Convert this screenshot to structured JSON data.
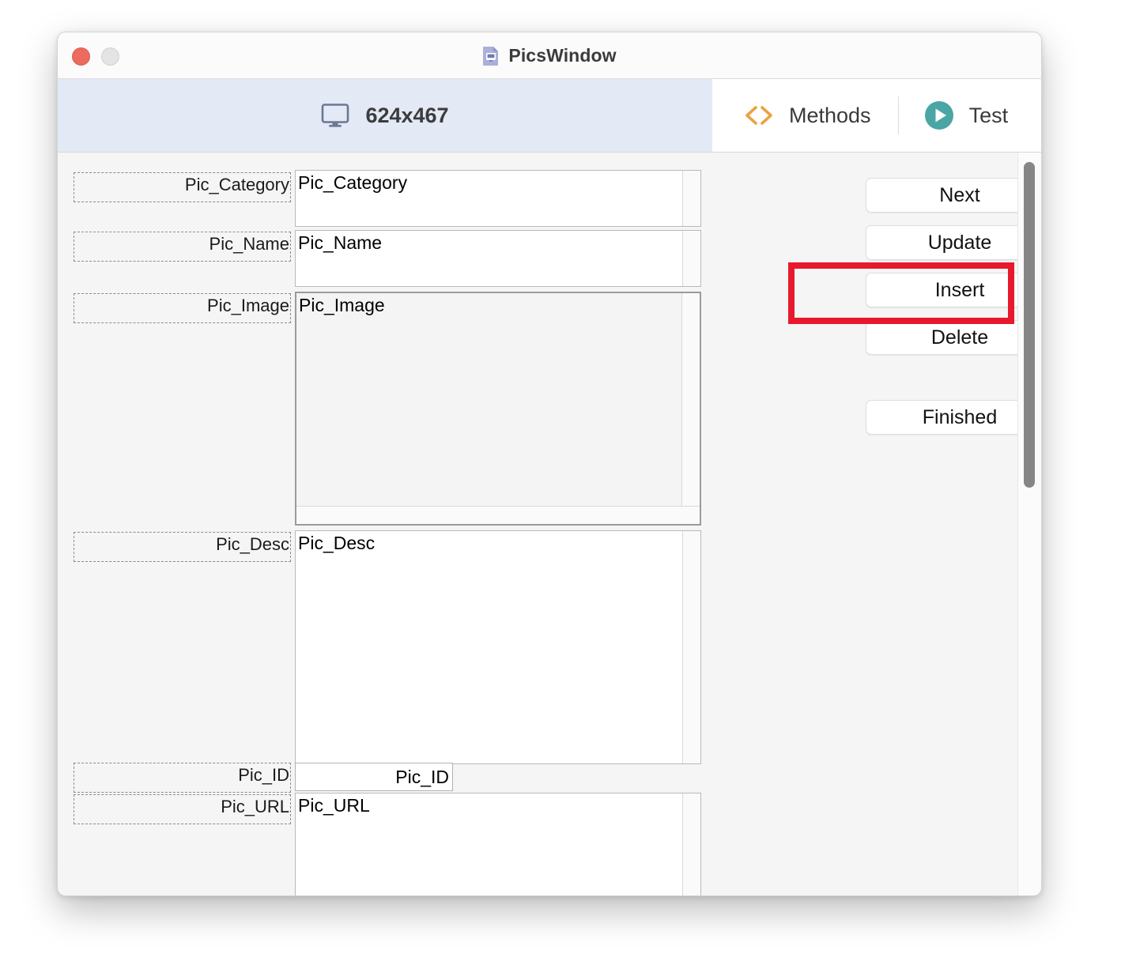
{
  "window": {
    "title": "PicsWindow",
    "title_icon": "document-window-icon",
    "traffic_lights": [
      "close",
      "minimize"
    ]
  },
  "toolbar": {
    "size_tab": {
      "icon": "monitor-icon",
      "label": "624x467"
    },
    "methods_tab": {
      "icon": "code-brackets-icon",
      "label": "Methods"
    },
    "test_tab": {
      "icon": "play-circle-icon",
      "label": "Test"
    }
  },
  "form": {
    "fields": [
      {
        "label": "Pic_Category",
        "value": "Pic_Category",
        "type": "textarea",
        "focused": false
      },
      {
        "label": "Pic_Name",
        "value": "Pic_Name",
        "type": "textarea",
        "focused": false
      },
      {
        "label": "Pic_Image",
        "value": "Pic_Image",
        "type": "textarea",
        "focused": true
      },
      {
        "label": "Pic_Desc",
        "value": "Pic_Desc",
        "type": "textarea",
        "focused": false
      },
      {
        "label": "Pic_ID",
        "value": "Pic_ID",
        "type": "textfield",
        "focused": false
      },
      {
        "label": "Pic_URL",
        "value": "Pic_URL",
        "type": "textarea",
        "focused": false
      }
    ]
  },
  "actions": {
    "buttons": [
      {
        "label": "Next"
      },
      {
        "label": "Update"
      },
      {
        "label": "Insert"
      },
      {
        "label": "Delete"
      },
      {
        "label": "Finished"
      }
    ],
    "highlighted": "Insert"
  },
  "colors": {
    "tab_active_bg": "#e3e9f5",
    "methods_icon": "#eda23d",
    "test_icon": "#4aa5a5",
    "highlight": "#e8192c",
    "close_light": "#ec6a5e",
    "min_light": "#e4e4e4",
    "content_bg": "#f5f5f5"
  }
}
